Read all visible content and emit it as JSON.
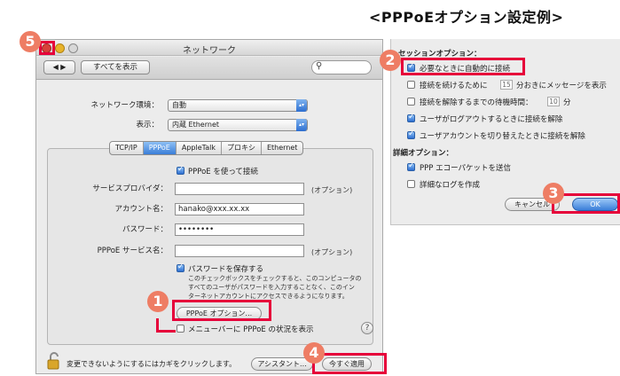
{
  "header": {
    "title": "<PPPoEオプション設定例>"
  },
  "window": {
    "title": "ネットワーク",
    "nav_back": "◀ ▶",
    "show_all": "すべてを表示",
    "search_icon": "search-icon",
    "location_label": "ネットワーク環境：",
    "location_value": "自動",
    "show_label": "表示：",
    "show_value": "内蔵 Ethernet",
    "tabs": [
      "TCP/IP",
      "PPPoE",
      "AppleTalk",
      "プロキシ",
      "Ethernet"
    ],
    "active_tab": "PPPoE",
    "connect_using_pppoe": "PPPoE を使って接続",
    "provider_label": "サービスプロバイダ：",
    "provider_value": "",
    "provider_optional": "(オプション)",
    "account_label": "アカウント名：",
    "account_value": "hanako@xxx.xx.xx",
    "password_label": "パスワード：",
    "password_value": "••••••••",
    "service_label": "PPPoE サービス名：",
    "service_value": "",
    "service_optional": "(オプション)",
    "save_password": "パスワードを保存する",
    "save_note_1": "このチェックボックスをチェックすると、このコンピュータの",
    "save_note_2": "すべてのユーザがパスワードを入力することなく、このイン",
    "save_note_3": "ターネットアカウントにアクセスできるようになります。",
    "pppoe_options_button": "PPPoE オプション...",
    "show_in_menubar": "メニューバーに PPPoE の状況を表示",
    "help": "?",
    "lock_text": "変更できないようにするにはカギをクリックします。",
    "assistant_button": "アシスタント...",
    "apply_button": "今すぐ適用"
  },
  "options": {
    "session_header": "セッションオプション：",
    "auto_connect": "必要なときに自動的に接続",
    "keep_prefix": "接続を続けるために",
    "keep_value": "15",
    "keep_suffix": "分おきにメッセージを表示",
    "disconnect_prefix": "接続を解除するまでの待機時間：",
    "disconnect_value": "10",
    "disconnect_suffix": "分",
    "logout_disconnect": "ユーザがログアウトするときに接続を解除",
    "switch_disconnect": "ユーザアカウントを切り替えたときに接続を解除",
    "advanced_header": "詳細オプション：",
    "send_echo": "PPP エコーパケットを送信",
    "verbose_log": "詳細なログを作成",
    "cancel_button": "キャンセル",
    "ok_button": "OK"
  },
  "annotations": {
    "step1": "1",
    "step2": "2",
    "step3": "3",
    "step4": "4",
    "step5": "5",
    "color": "#e6003a",
    "badge_color": "#ee7d64"
  }
}
